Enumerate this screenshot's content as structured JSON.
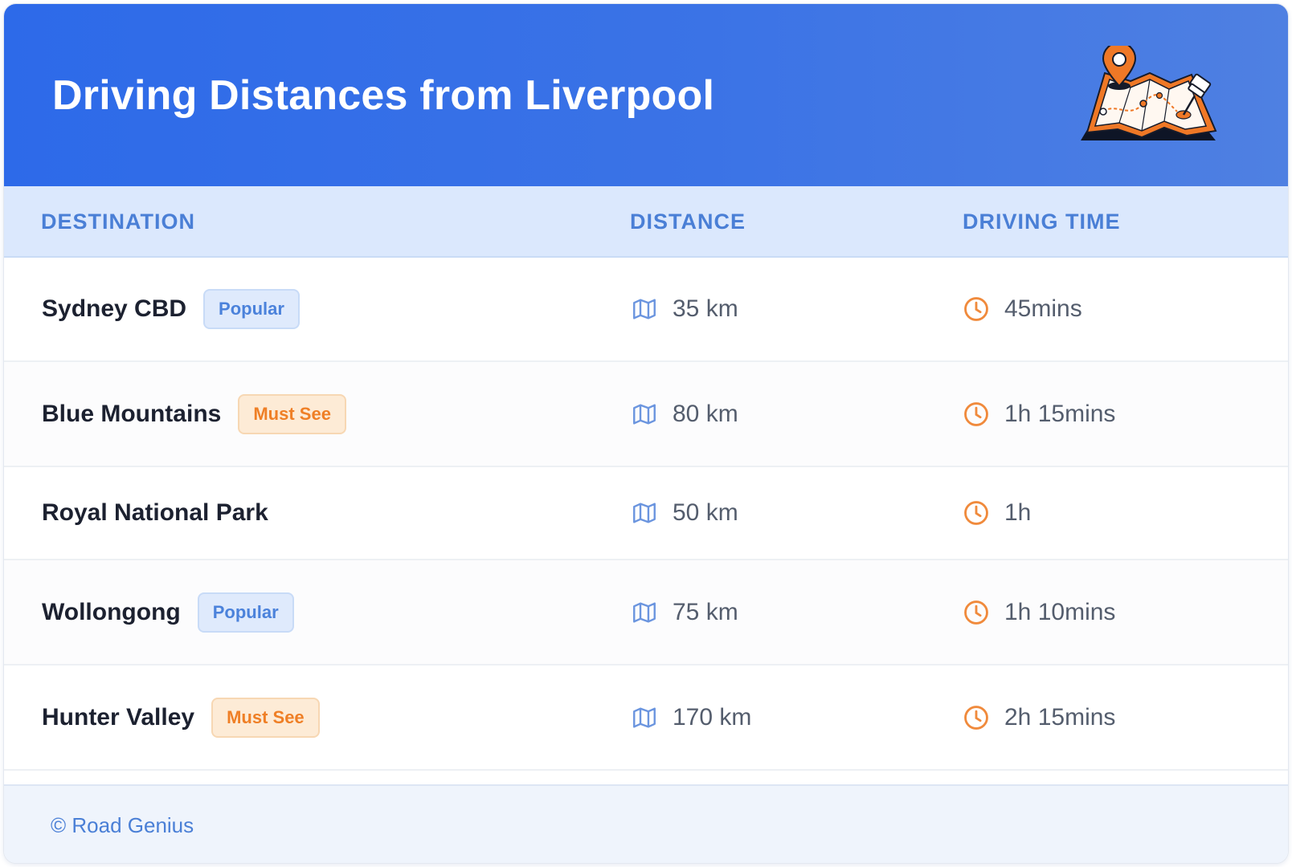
{
  "header": {
    "title": "Driving Distances from Liverpool",
    "illustration_icon": "folded-map-with-location-pin-icon"
  },
  "columns": {
    "destination": "DESTINATION",
    "distance": "DISTANCE",
    "driving_time": "DRIVING TIME"
  },
  "rows": [
    {
      "destination": "Sydney CBD",
      "badge": "Popular",
      "badge_type": "popular",
      "distance": "35 km",
      "time": "45mins"
    },
    {
      "destination": "Blue Mountains",
      "badge": "Must See",
      "badge_type": "mustsee",
      "distance": "80 km",
      "time": "1h 15mins"
    },
    {
      "destination": "Royal National Park",
      "badge": "",
      "badge_type": "",
      "distance": "50 km",
      "time": "1h"
    },
    {
      "destination": "Wollongong",
      "badge": "Popular",
      "badge_type": "popular",
      "distance": "75 km",
      "time": "1h 10mins"
    },
    {
      "destination": "Hunter Valley",
      "badge": "Must See",
      "badge_type": "mustsee",
      "distance": "170 km",
      "time": "2h 15mins"
    }
  ],
  "icons": {
    "distance": "map-icon",
    "time": "clock-icon"
  },
  "footer": {
    "text": "© Road Genius"
  },
  "colors": {
    "header_blue": "#2d6ae9",
    "accent_blue": "#4a7fd6",
    "accent_orange": "#ef7f26"
  }
}
